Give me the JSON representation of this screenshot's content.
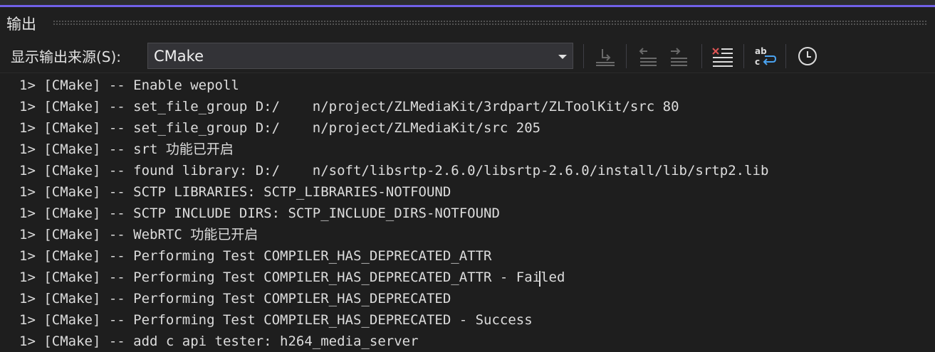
{
  "panel": {
    "title": "输出"
  },
  "toolbar": {
    "source_label": "显示输出来源(S):",
    "source_value": "CMake",
    "buttons": [
      {
        "name": "go-to-location-icon"
      },
      {
        "name": "previous-message-icon"
      },
      {
        "name": "next-message-icon"
      },
      {
        "name": "clear-all-icon"
      },
      {
        "name": "toggle-word-wrap-icon"
      },
      {
        "name": "show-timestamp-icon"
      }
    ]
  },
  "output": {
    "lines": [
      "1> [CMake] -- Enable wepoll",
      "1> [CMake] -- set_file_group D:/    n/project/ZLMediaKit/3rdpart/ZLToolKit/src 80",
      "1> [CMake] -- set_file_group D:/    n/project/ZLMediaKit/src 205",
      "1> [CMake] -- srt 功能已开启",
      "1> [CMake] -- found library: D:/    n/soft/libsrtp-2.6.0/libsrtp-2.6.0/install/lib/srtp2.lib",
      "1> [CMake] -- SCTP LIBRARIES: SCTP_LIBRARIES-NOTFOUND",
      "1> [CMake] -- SCTP INCLUDE DIRS: SCTP_INCLUDE_DIRS-NOTFOUND",
      "1> [CMake] -- WebRTC 功能已开启",
      "1> [CMake] -- Performing Test COMPILER_HAS_DEPRECATED_ATTR",
      "1> [CMake] -- Performing Test COMPILER_HAS_DEPRECATED_ATTR - Failed",
      "1> [CMake] -- Performing Test COMPILER_HAS_DEPRECATED",
      "1> [CMake] -- Performing Test COMPILER_HAS_DEPRECATED - Success",
      "1> [CMake] -- add c api tester: h264_media_server"
    ]
  },
  "colors": {
    "accent": "#7160e8",
    "background": "#1e1e1e",
    "text": "#dcdcdc"
  }
}
